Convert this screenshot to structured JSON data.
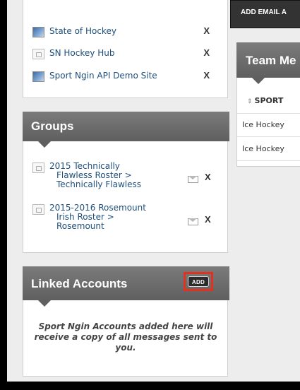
{
  "sites": [
    {
      "name": "State of Hockey",
      "remove_label": "X",
      "thumb": "image"
    },
    {
      "name": "SN Hockey Hub",
      "remove_label": "X",
      "thumb": "broken"
    },
    {
      "name": "Sport Ngin API Demo Site",
      "remove_label": "X",
      "thumb": "image"
    }
  ],
  "groups": {
    "title": "Groups",
    "items": [
      {
        "line1": "2015 Technically",
        "line2": "Flawless Roster >",
        "line3": "Technically Flawless",
        "remove_label": "X",
        "mail_icon": "envelope-icon"
      },
      {
        "line1": "2015-2016 Rosemount",
        "line2": "Irish Roster >",
        "line3": "Rosemount",
        "remove_label": "X",
        "mail_icon": "envelope-icon"
      }
    ]
  },
  "linked_accounts": {
    "title": "Linked Accounts",
    "add_label": "ADD",
    "note": "Sport Ngin Accounts added here will receive a copy of all messages sent to you."
  },
  "right": {
    "add_email_label": "ADD EMAIL A",
    "team_title": "Team Me",
    "column_header": "SPORT",
    "rows": [
      "Ice Hockey",
      "Ice Hockey"
    ]
  },
  "colors": {
    "highlight": "#e2311d",
    "link": "#1f4e7a",
    "header": "#666666"
  }
}
